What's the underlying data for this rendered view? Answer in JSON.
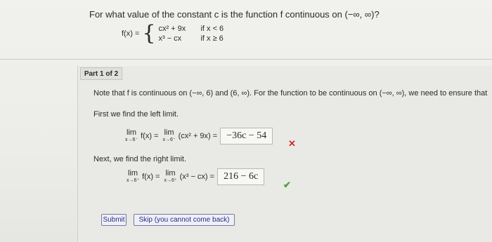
{
  "question": "For what value of the constant c is the function f continuous on (−∞, ∞)?",
  "function_def": {
    "lhs": "f(x) =",
    "cases": [
      {
        "expr": "cx² + 9x",
        "cond": "if x < 6"
      },
      {
        "expr": "x³ − cx",
        "cond": "if x ≥ 6"
      }
    ]
  },
  "part_label": "Part 1 of 2",
  "note": "Note that f is continuous on (−∞, 6) and (6, ∞). For the function to be continuous on (−∞, ∞), we need to ensure that",
  "left_intro": "First we find the left limit.",
  "left_limit": {
    "lim1": "lim",
    "sub1": "x→6⁻",
    "fx": "f(x) =",
    "lim2": "lim",
    "sub2": "x→6⁻",
    "expr": "(cx² + 9x) =",
    "answer": "−36c − 54",
    "status": "incorrect"
  },
  "right_intro": "Next, we find the right limit.",
  "right_limit": {
    "lim1": "lim",
    "sub1": "x→6⁺",
    "fx": "f(x) =",
    "lim2": "lim",
    "sub2": "x→6⁺",
    "expr": "(x³ − cx) =",
    "answer": "216 − 6c",
    "status": "correct"
  },
  "buttons": {
    "submit": "Submit",
    "skip": "Skip (you cannot come back)"
  },
  "icons": {
    "incorrect": "x-icon",
    "correct": "check-icon"
  },
  "colors": {
    "incorrect": "#d22a2a",
    "correct": "#4aa33a"
  }
}
